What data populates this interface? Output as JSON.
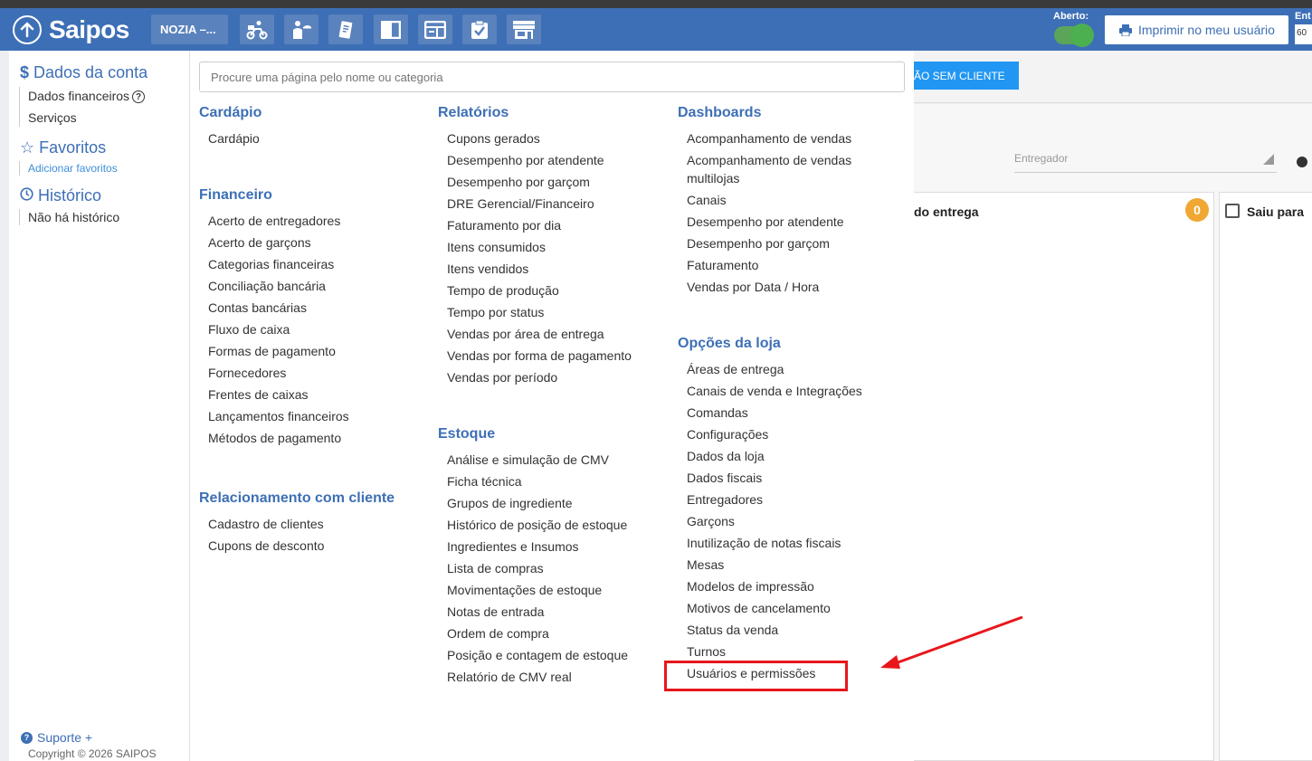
{
  "header": {
    "logo_text": "Saipos",
    "store_name": "NOZIA –...",
    "open_label": "Aberto:",
    "print_button": "Imprimir no meu usuário",
    "ent_label": "Ent",
    "ent_value": "60",
    "icons": [
      "delivery-icon",
      "waiter-icon",
      "order-pad-icon",
      "kanban-icon",
      "table-layout-icon",
      "clipboard-check-icon",
      "store-icon"
    ]
  },
  "background": {
    "sem_cliente_button": "ÃO SEM CLIENTE",
    "entregador_placeholder": "Entregador",
    "column1_title": "do entrega",
    "column1_badge": "0",
    "column2_title": "Saiu para"
  },
  "sidebar": {
    "account_title": "Dados da conta",
    "account_items": [
      "Dados financeiros",
      "Serviços"
    ],
    "favorites_title": "Favoritos",
    "favorites_add": "Adicionar favoritos",
    "history_title": "Histórico",
    "history_empty": "Não há histórico",
    "support": "Suporte +",
    "copyright": "Copyright © 2026 SAIPOS"
  },
  "menu": {
    "search_placeholder": "Procure uma página pelo nome ou categoria",
    "columns": [
      [
        {
          "title": "Cardápio",
          "items": [
            "Cardápio"
          ]
        },
        {
          "title": "Financeiro",
          "items": [
            "Acerto de entregadores",
            "Acerto de garçons",
            "Categorias financeiras",
            "Conciliação bancária",
            "Contas bancárias",
            "Fluxo de caixa",
            "Formas de pagamento",
            "Fornecedores",
            "Frentes de caixas",
            "Lançamentos financeiros",
            "Métodos de pagamento"
          ]
        },
        {
          "title": "Relacionamento com cliente",
          "items": [
            "Cadastro de clientes",
            "Cupons de desconto"
          ]
        }
      ],
      [
        {
          "title": "Relatórios",
          "items": [
            "Cupons gerados",
            "Desempenho por atendente",
            "Desempenho por garçom",
            "DRE Gerencial/Financeiro",
            "Faturamento por dia",
            "Itens consumidos",
            "Itens vendidos",
            "Tempo de produção",
            "Tempo por status",
            "Vendas por área de entrega",
            "Vendas por forma de pagamento",
            "Vendas por período"
          ]
        },
        {
          "title": "Estoque",
          "items": [
            "Análise e simulação de CMV",
            "Ficha técnica",
            "Grupos de ingrediente",
            "Histórico de posição de estoque",
            "Ingredientes e Insumos",
            "Lista de compras",
            "Movimentações de estoque",
            "Notas de entrada",
            "Ordem de compra",
            "Posição e contagem de estoque",
            "Relatório de CMV real"
          ]
        }
      ],
      [
        {
          "title": "Dashboards",
          "items": [
            "Acompanhamento de vendas",
            "Acompanhamento de vendas multilojas",
            "Canais",
            "Desempenho por atendente",
            "Desempenho por garçom",
            "Faturamento",
            "Vendas por Data / Hora"
          ]
        },
        {
          "title": "Opções da loja",
          "items": [
            "Áreas de entrega",
            "Canais de venda e Integrações",
            "Comandas",
            "Configurações",
            "Dados da loja",
            "Dados fiscais",
            "Entregadores",
            "Garçons",
            "Inutilização de notas fiscais",
            "Mesas",
            "Modelos de impressão",
            "Motivos de cancelamento",
            "Status da venda",
            "Turnos",
            "Usuários e permissões"
          ]
        }
      ]
    ]
  },
  "colors": {
    "header_bg": "#3d6fb6",
    "accent_blue": "#2196f3",
    "badge_orange": "#f0a733",
    "highlight_red": "#e8161b",
    "toggle_green": "#4caf50"
  }
}
